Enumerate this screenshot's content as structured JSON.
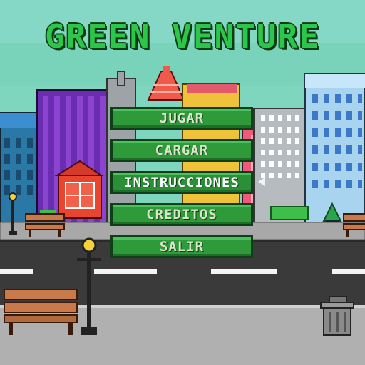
{
  "game": {
    "title": "GREEN VENTURE"
  },
  "menu": {
    "items": [
      {
        "label": "JUGAR"
      },
      {
        "label": "CARGAR"
      },
      {
        "label": "INSTRUCCIONES"
      },
      {
        "label": "CREDITOS"
      },
      {
        "label": "SALIR"
      }
    ],
    "selected_label": "INSTRUCCIONES"
  },
  "colors": {
    "sky": "#7ad3b9",
    "title_green": "#2cc64a",
    "button_green": "#2e9a3a",
    "road": "#3a3a3a",
    "sidewalk": "#a5a5a5"
  },
  "icons": {
    "cursor": "pointer-arrow-icon",
    "trash": "trash-can-icon",
    "lamp": "street-lamp-icon",
    "bench": "park-bench-icon"
  }
}
